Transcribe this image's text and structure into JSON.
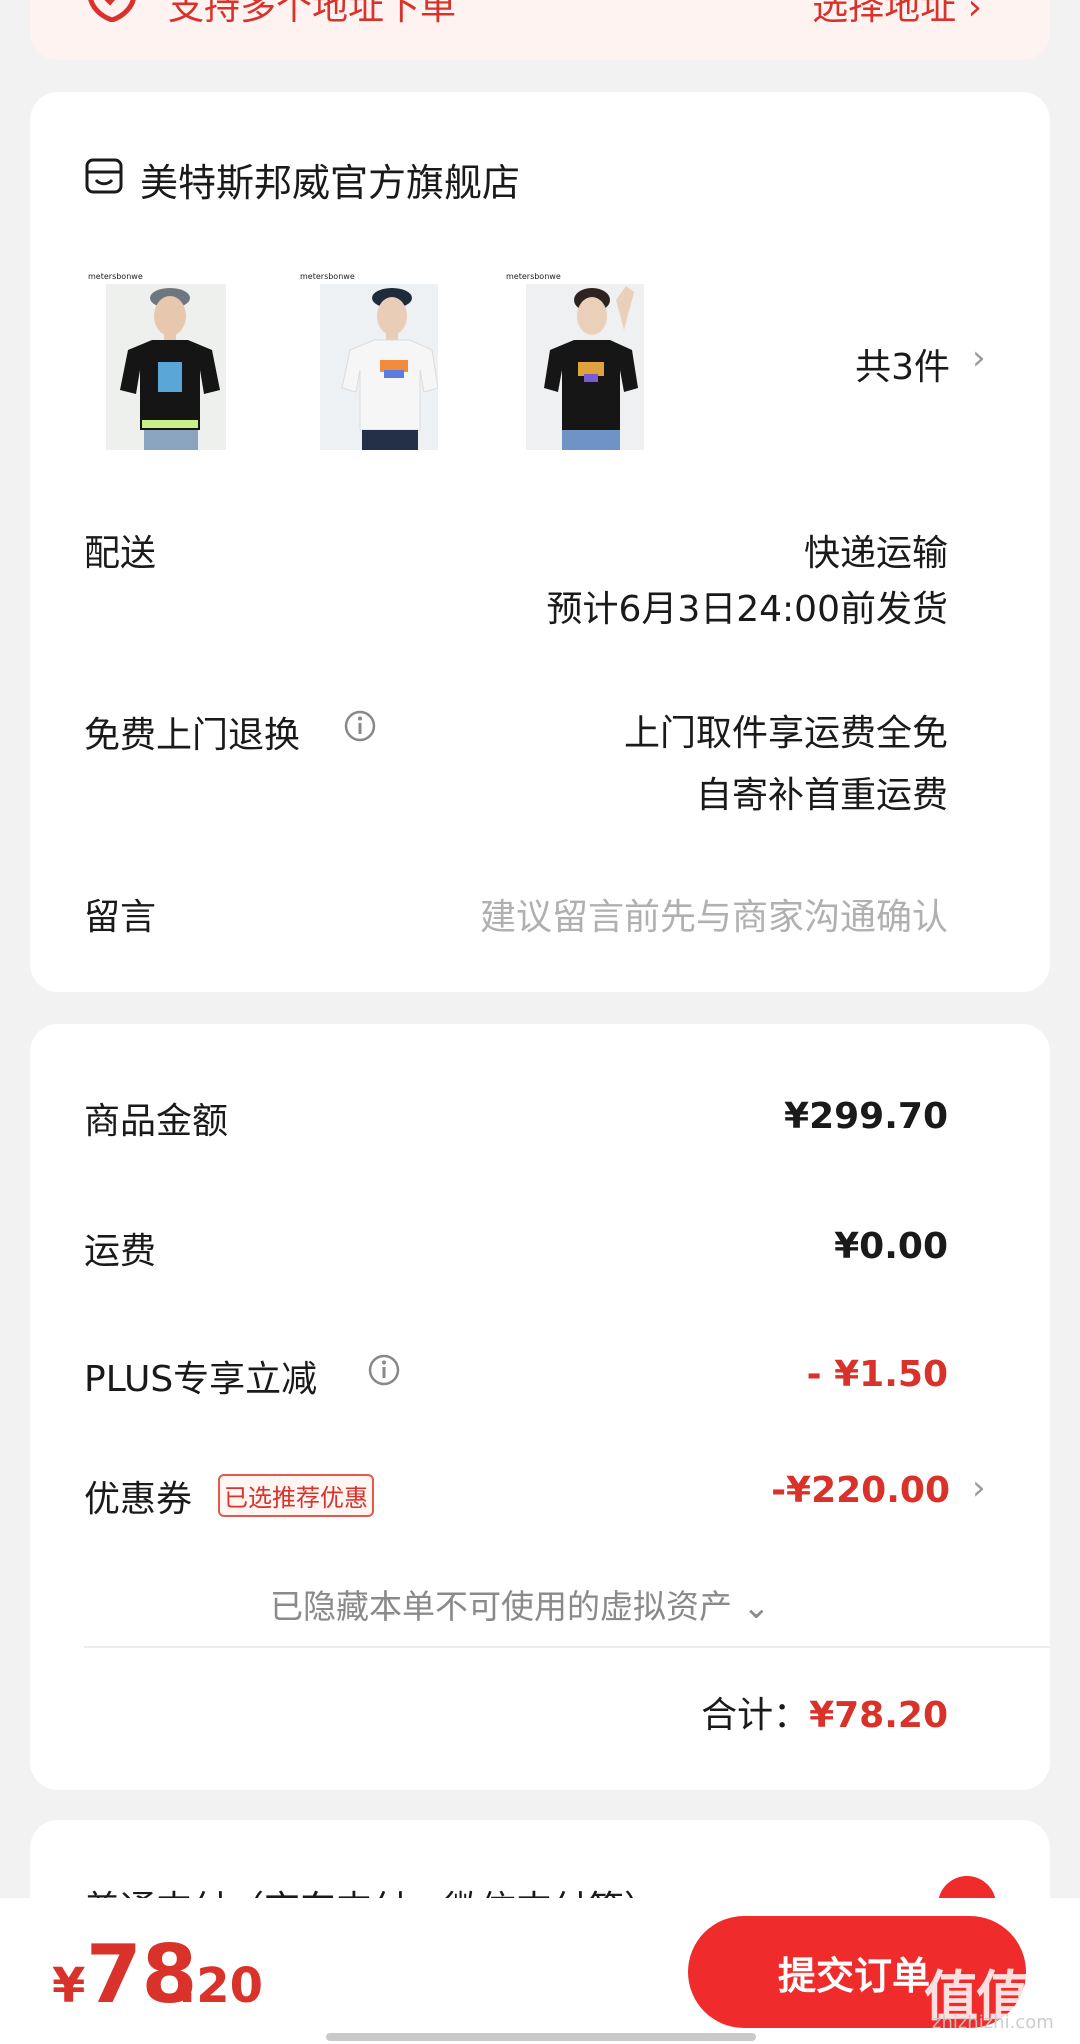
{
  "address": {
    "text": "支持多个地址下单",
    "select_label": "选择地址",
    "select_chevron": "›",
    "icon": "location-shield-icon"
  },
  "store": {
    "name": "美特斯邦威官方旗舰店",
    "icon": "store-icon",
    "thumb_logo": "metersbonwe",
    "item_count": "共3件",
    "chevron": "›"
  },
  "delivery": {
    "label": "配送",
    "method": "快递运输",
    "estimate": "预计6月3日24:00前发货"
  },
  "return": {
    "label": "免费上门退换",
    "line1": "上门取件享运费全免",
    "line2": "自寄补首重运费"
  },
  "message": {
    "label": "留言",
    "placeholder": "建议留言前先与商家沟通确认"
  },
  "pricing": {
    "goods_label": "商品金额",
    "goods_value": "¥299.70",
    "shipping_label": "运费",
    "shipping_value": "¥0.00",
    "plus_label": "PLUS专享立减",
    "plus_value": "- ¥1.50",
    "coupon_label": "优惠券",
    "coupon_badge": "已选推荐优惠",
    "coupon_value": "-¥220.00",
    "coupon_chevron": "›",
    "hidden_assets": "已隐藏本单不可使用的虚拟资产",
    "hidden_chevron": "⌄",
    "total_label": "合计：",
    "total_value": "¥78.20"
  },
  "payment": {
    "partial_text": "普通支付（京东支付、微信支付等）"
  },
  "bottom": {
    "currency": "¥",
    "price_int": "78",
    "price_dec": ".20",
    "submit_label": "提交订单"
  },
  "watermark": {
    "text": "值值值",
    "sub": "zhizhizhi.com"
  },
  "colors": {
    "accent": "#d8322a",
    "button": "#f02b2b",
    "background": "#f2f2f2"
  }
}
